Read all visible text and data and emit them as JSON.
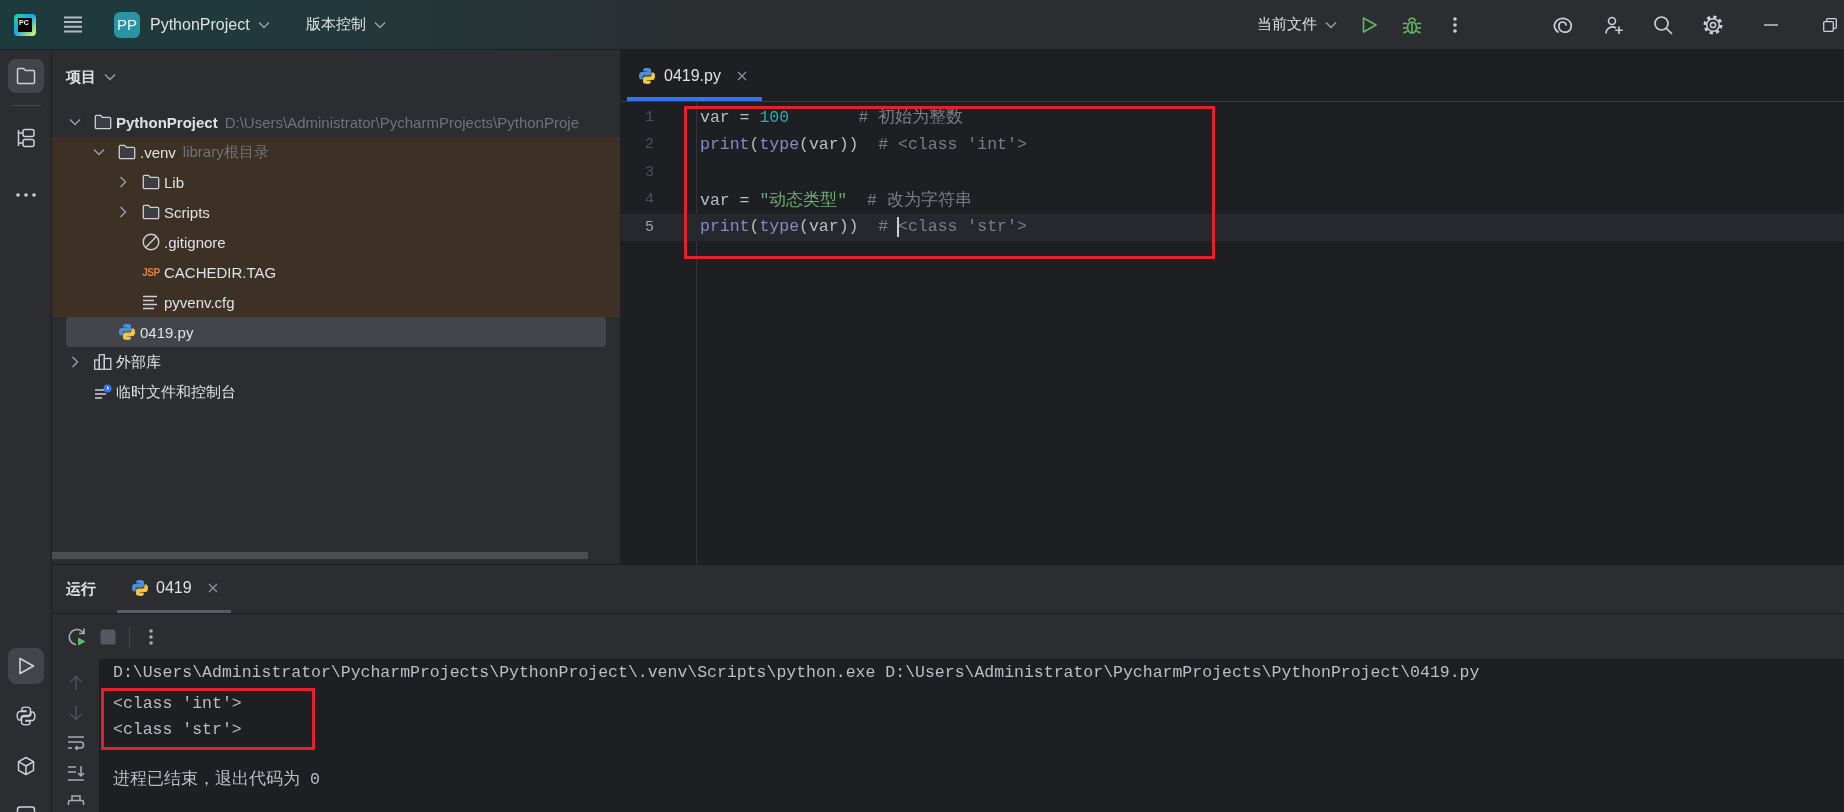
{
  "top_bar": {
    "logo": "PC",
    "project": {
      "badge": "PP",
      "name": "PythonProject"
    },
    "vcs_menu": "版本控制",
    "run_config": "当前文件"
  },
  "left_toolbar": {
    "top": [
      {
        "kind": "project",
        "selected": true
      },
      {
        "kind": "structure",
        "selected": false
      },
      {
        "kind": "more",
        "selected": false
      }
    ],
    "bottom": [
      {
        "kind": "run",
        "selected": true
      },
      {
        "kind": "python-console",
        "selected": false
      },
      {
        "kind": "services",
        "selected": false
      },
      {
        "kind": "terminal",
        "selected": false
      }
    ]
  },
  "project_panel": {
    "title": "项目",
    "tree": [
      {
        "label": "PythonProject",
        "kind": "project",
        "hint": "D:\\Users\\Administrator\\PycharmProjects\\PythonProje",
        "expanded": true,
        "selected": false,
        "children": [
          {
            "label": ".venv",
            "kind": "folder",
            "hint": "library根目录",
            "library_root": true,
            "expanded": true,
            "selected": false,
            "children": [
              {
                "label": "Lib",
                "kind": "folder",
                "expanded": false,
                "selected": false
              },
              {
                "label": "Scripts",
                "kind": "folder",
                "expanded": false,
                "selected": false
              },
              {
                "label": ".gitignore",
                "kind": "ignore-file",
                "selected": false
              },
              {
                "label": "CACHEDIR.TAG",
                "kind": "tag-file",
                "icon_text": "JSP",
                "selected": false
              },
              {
                "label": "pyvenv.cfg",
                "kind": "config-file",
                "selected": false
              }
            ]
          },
          {
            "label": "0419.py",
            "kind": "python-file",
            "library_root": false,
            "selected": true
          }
        ]
      },
      {
        "label": "外部库",
        "kind": "libraries",
        "expanded": false,
        "selected": false
      },
      {
        "label": "临时文件和控制台",
        "kind": "scratches",
        "selected": false
      }
    ]
  },
  "editor": {
    "tabs": [
      {
        "label": "0419.py",
        "selected": true
      }
    ],
    "highlighted": true,
    "lines": [
      {
        "number": "1",
        "current": false,
        "tokens": [
          {
            "text": "var = ",
            "kind": "plain"
          },
          {
            "text": "100",
            "kind": "number"
          },
          {
            "text": "       # 初始为整数",
            "kind": "comment"
          }
        ]
      },
      {
        "number": "2",
        "current": false,
        "tokens": [
          {
            "text": "print",
            "kind": "builtin"
          },
          {
            "text": "(",
            "kind": "plain"
          },
          {
            "text": "type",
            "kind": "builtin"
          },
          {
            "text": "(var))",
            "kind": "plain"
          },
          {
            "text": "  # <class 'int'>",
            "kind": "comment"
          }
        ]
      },
      {
        "number": "3",
        "current": false
      },
      {
        "number": "4",
        "current": false,
        "tokens": [
          {
            "text": "var = ",
            "kind": "plain"
          },
          {
            "text": "\"动态类型\"",
            "kind": "string"
          },
          {
            "text": "  # 改为字符串",
            "kind": "comment"
          }
        ]
      },
      {
        "number": "5",
        "current": true,
        "tokens": [
          {
            "text": "print",
            "kind": "builtin"
          },
          {
            "text": "(",
            "kind": "plain"
          },
          {
            "text": "type",
            "kind": "builtin"
          },
          {
            "text": "(var))",
            "kind": "plain"
          },
          {
            "text": "  # ",
            "kind": "comment"
          },
          {
            "kind": "caret"
          },
          {
            "text": "<class 'str'>",
            "kind": "comment"
          }
        ]
      }
    ]
  },
  "run_panel": {
    "title": "运行",
    "tabs": [
      {
        "label": "0419",
        "selected": true
      }
    ],
    "toolbar": [
      {
        "kind": "rerun",
        "disabled": false
      },
      {
        "kind": "stop",
        "disabled": true
      },
      {
        "kind": "more",
        "disabled": false
      }
    ],
    "gutter": [
      {
        "kind": "up",
        "disabled": true
      },
      {
        "kind": "down",
        "disabled": true
      },
      {
        "kind": "soft-wrap",
        "disabled": false
      },
      {
        "kind": "scroll-to-end",
        "disabled": false
      },
      {
        "kind": "print",
        "disabled": false
      }
    ],
    "command": "D:\\Users\\Administrator\\PycharmProjects\\PythonProject\\.venv\\Scripts\\python.exe D:\\Users\\Administrator\\PycharmProjects\\PythonProject\\0419.py",
    "output": {
      "highlighted": true,
      "lines": [
        "<class 'int'>",
        "<class 'str'>"
      ]
    },
    "exit_message": "进程已结束，退出代码为 0"
  }
}
